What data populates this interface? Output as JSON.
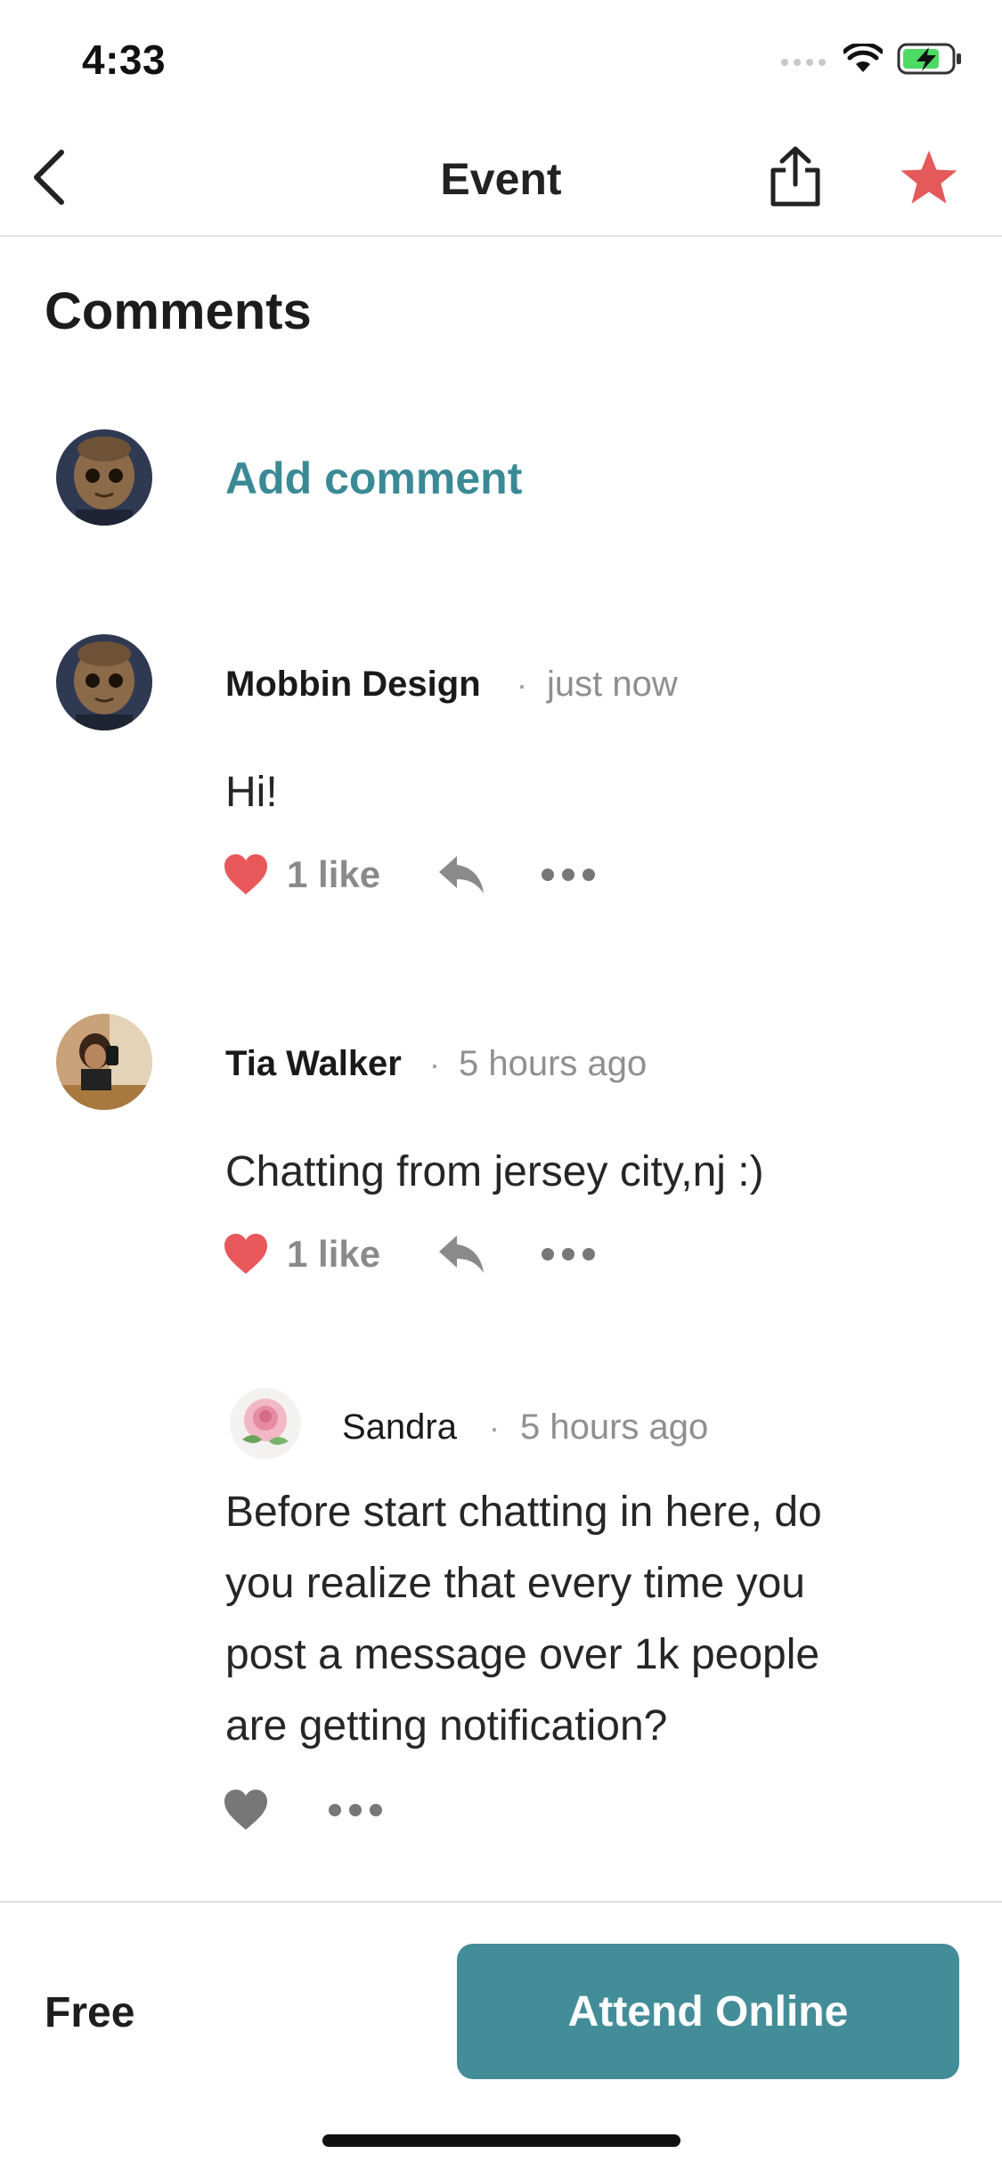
{
  "status_bar": {
    "time": "4:33"
  },
  "nav": {
    "title": "Event"
  },
  "comments_section": {
    "title": "Comments",
    "add_comment_label": "Add comment"
  },
  "comments": [
    {
      "author": "Mobbin Design",
      "time": "just now",
      "text": "Hi!",
      "likes": "1 like"
    },
    {
      "author": "Tia Walker",
      "time": "5 hours ago",
      "text": "Chatting from jersey city,nj :)",
      "likes": "1 like"
    }
  ],
  "reply": {
    "author": "Sandra",
    "time": "5 hours ago",
    "lines": [
      "Before start chatting in here, do",
      "you realize that every time you",
      "post a message over 1k people",
      "are getting notification?"
    ]
  },
  "bottom": {
    "price": "Free",
    "attend_label": "Attend Online"
  },
  "colors": {
    "accent": "#438d98",
    "link": "#3a8a95",
    "like_red": "#e8575a",
    "star_red": "#e45a5b"
  }
}
